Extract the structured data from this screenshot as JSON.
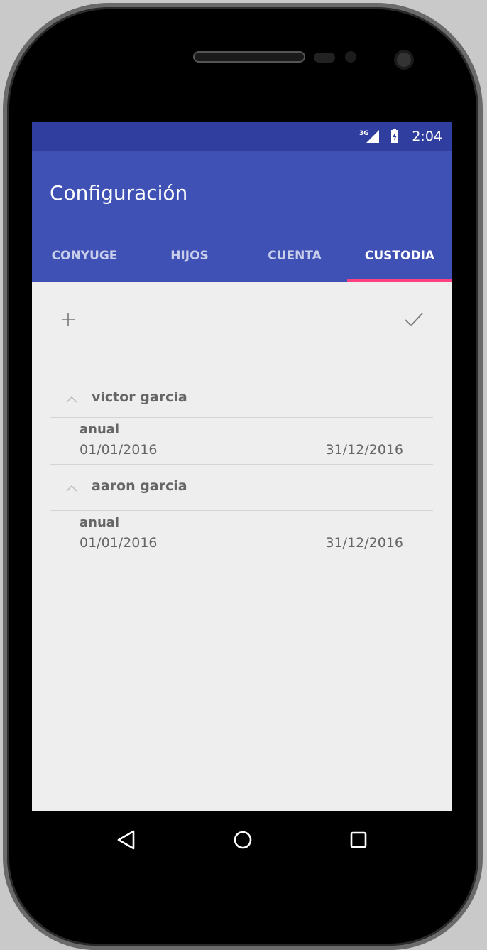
{
  "status_bar": {
    "network": "3G",
    "time": "2:04"
  },
  "app_bar": {
    "title": "Configuración"
  },
  "tabs": [
    {
      "label": "CONYUGE",
      "active": false
    },
    {
      "label": "HIJOS",
      "active": false
    },
    {
      "label": "CUENTA",
      "active": false
    },
    {
      "label": "CUSTODIA",
      "active": true
    }
  ],
  "toolbar": {
    "add_icon": "plus-icon",
    "confirm_icon": "check-icon"
  },
  "custody_groups": [
    {
      "name": "victor garcia",
      "expanded": true,
      "entries": [
        {
          "type": "anual",
          "start": "01/01/2016",
          "end": "31/12/2016"
        }
      ]
    },
    {
      "name": "aaron garcia",
      "expanded": true,
      "entries": [
        {
          "type": "anual",
          "start": "01/01/2016",
          "end": "31/12/2016"
        }
      ]
    }
  ],
  "colors": {
    "primary": "#3f51b5",
    "primary_dark": "#303f9f",
    "accent": "#ff4081",
    "background": "#eeeeee"
  }
}
